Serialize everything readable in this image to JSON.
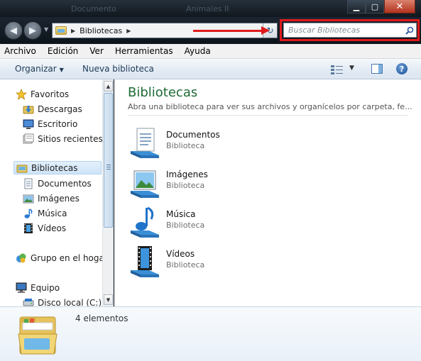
{
  "window": {
    "ghost_titles": [
      "Documento",
      "Animales II"
    ]
  },
  "navigation": {
    "address_segment": "Bibliotecas",
    "search_placeholder": "Buscar Bibliotecas"
  },
  "menubar": {
    "items": [
      "Archivo",
      "Edición",
      "Ver",
      "Herramientas",
      "Ayuda"
    ]
  },
  "commandbar": {
    "organize_label": "Organizar",
    "new_library_label": "Nueva biblioteca"
  },
  "navpane": {
    "favorites": "Favoritos",
    "downloads": "Descargas",
    "desktop": "Escritorio",
    "recent": "Sitios recientes",
    "libraries": "Bibliotecas",
    "documents": "Documentos",
    "images": "Imágenes",
    "music": "Música",
    "videos": "Vídeos",
    "homegroup": "Grupo en el hogar",
    "computer": "Equipo",
    "local_disk": "Disco local (C:)"
  },
  "content": {
    "title": "Bibliotecas",
    "description": "Abra una biblioteca para ver sus archivos y organícelos por carpeta, fe...",
    "libraries": [
      {
        "name": "Documentos",
        "type": "Biblioteca",
        "icon": "documents-library-icon"
      },
      {
        "name": "Imágenes",
        "type": "Biblioteca",
        "icon": "pictures-library-icon"
      },
      {
        "name": "Música",
        "type": "Biblioteca",
        "icon": "music-library-icon"
      },
      {
        "name": "Vídeos",
        "type": "Biblioteca",
        "icon": "videos-library-icon"
      }
    ]
  },
  "details": {
    "item_count": "4 elementos"
  },
  "colors": {
    "title_green": "#1f6b35",
    "annotation_red": "#e01b1b",
    "selection_blue": "#cfe4f8"
  }
}
